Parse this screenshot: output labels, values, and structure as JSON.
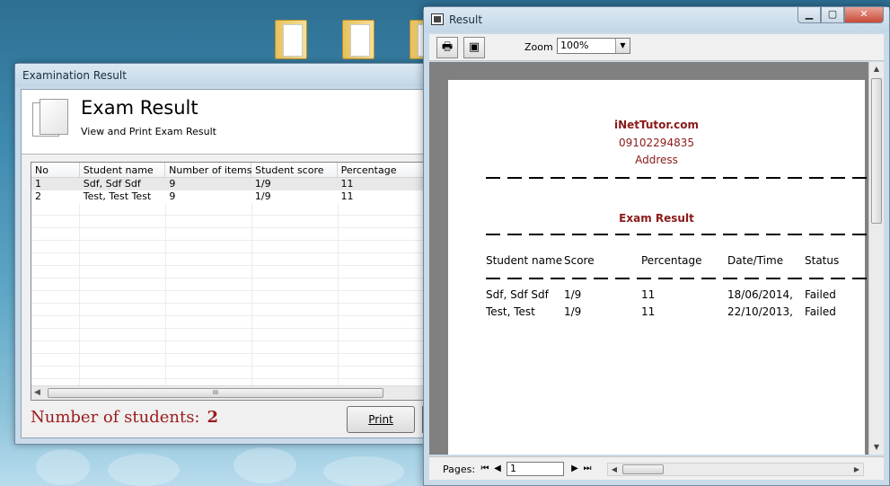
{
  "desktop": {
    "icons": [
      {
        "label": "",
        "icon": "folder-icon"
      },
      {
        "label": "",
        "icon": "folder-icon"
      },
      {
        "label": "",
        "icon": "folder-icon"
      }
    ]
  },
  "exam_window": {
    "title": "Examination Result",
    "banner_title": "Exam Result",
    "banner_subtitle": "View and Print Exam Result",
    "columns": [
      "No",
      "Student name",
      "Number of items",
      "Student score",
      "Percentage"
    ],
    "rows": [
      [
        "1",
        "Sdf, Sdf Sdf",
        "9",
        "1/9",
        "11"
      ],
      [
        "2",
        "Test, Test Test",
        "9",
        "1/9",
        "11"
      ]
    ],
    "students_label": "Number of students:",
    "students_count": "2",
    "print_label": "Print",
    "scroll_grip": "III",
    "colors": {
      "count_text": "#9b1a1a",
      "selected_row": "#e8e8e8"
    }
  },
  "result_window": {
    "title": "Result",
    "zoom_label": "Zoom",
    "zoom_value": "100%",
    "pages_label": "Pages:",
    "page_value": "1",
    "report": {
      "company": "iNetTutor.com",
      "phone": "09102294835",
      "address": "Address",
      "title": "Exam Result",
      "columns": [
        "Student name",
        "Score",
        "Percentage",
        "Date/Time",
        "Status"
      ],
      "rows": [
        [
          "Sdf, Sdf Sdf",
          "1/9",
          "11",
          "18/06/2014,",
          "Failed"
        ],
        [
          "Test, Test",
          "1/9",
          "11",
          "22/10/2013,",
          "Failed"
        ]
      ],
      "colors": {
        "header_text": "#8b1a1a"
      }
    },
    "caption_buttons": {
      "minimize": "minimize-icon",
      "maximize": "maximize-icon",
      "close": "close-icon"
    }
  }
}
